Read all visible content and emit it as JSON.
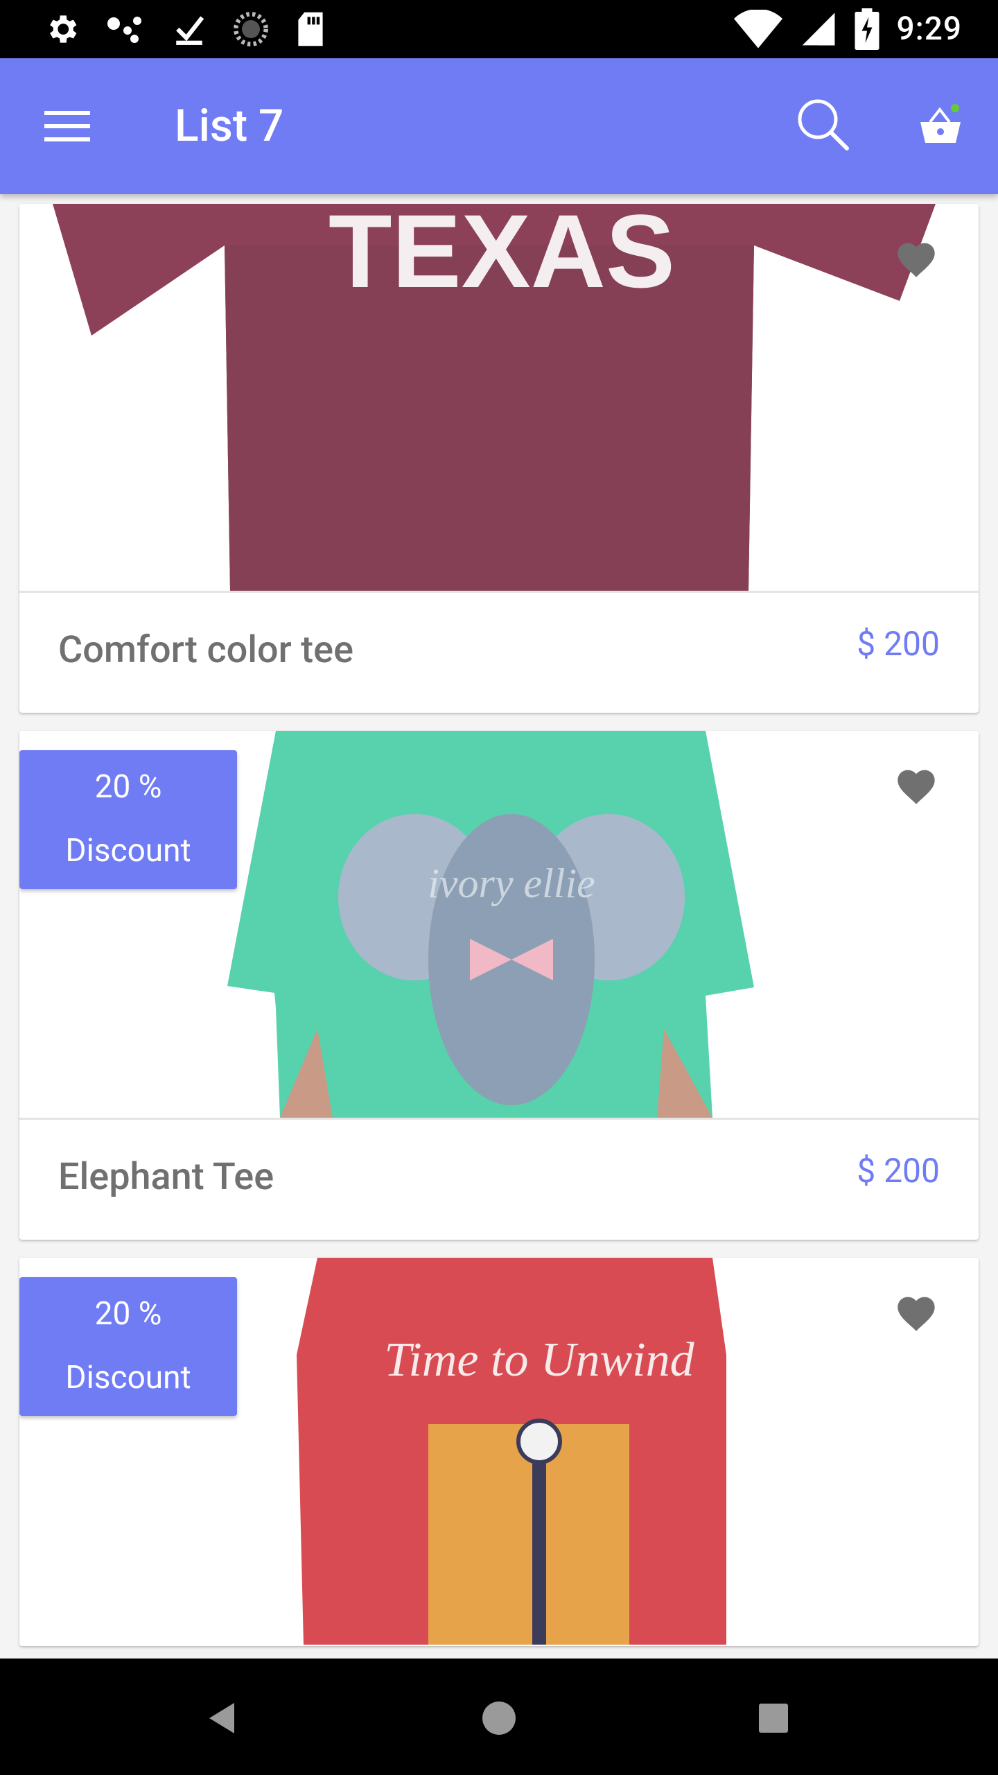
{
  "status_bar": {
    "time": "9:29",
    "icons": [
      "settings-icon",
      "assistant-dots-icon",
      "download-done-icon",
      "sync-circle-icon",
      "sd-card-icon",
      "wifi-icon",
      "cell-signal-icon",
      "battery-charging-icon"
    ]
  },
  "app_bar": {
    "title": "List 7",
    "background": "#707cf4",
    "menu_icon": "menu-icon",
    "search_icon": "search-icon",
    "cart_icon": "basket-icon",
    "cart_dot_color": "#66c93a"
  },
  "products": [
    {
      "name": "Comfort color tee",
      "price": "$ 200",
      "discount": null,
      "image": "maroon-texas-tshirt",
      "favorite_icon": "heart-icon"
    },
    {
      "name": "Elephant Tee",
      "price": "$ 200",
      "discount": {
        "percent": "20 %",
        "label": "Discount"
      },
      "image": "mint-elephant-tshirt",
      "favorite_icon": "heart-icon"
    },
    {
      "name": "",
      "price": "",
      "discount": {
        "percent": "20 %",
        "label": "Discount"
      },
      "image": "red-clock-longsleeve",
      "favorite_icon": "heart-icon"
    }
  ],
  "nav_bar": {
    "buttons": [
      "back-icon",
      "home-icon",
      "recents-icon"
    ]
  }
}
